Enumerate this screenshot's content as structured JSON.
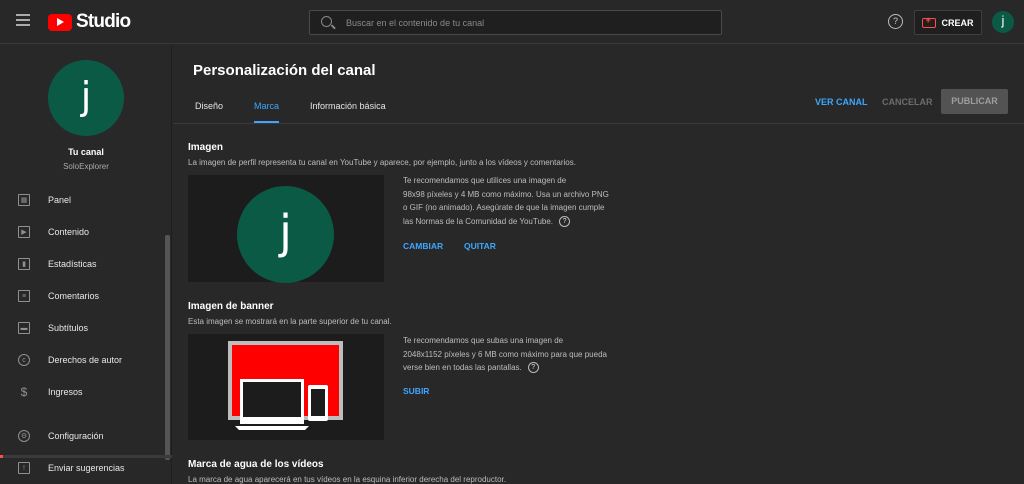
{
  "header": {
    "app_name": "Studio",
    "search_placeholder": "Buscar en el contenido de tu canal",
    "create_label": "CREAR",
    "avatar_letter": "j",
    "help_glyph": "?"
  },
  "sidebar": {
    "avatar_letter": "j",
    "channel_title": "Tu canal",
    "channel_name": "SoloExplorer",
    "items": [
      {
        "label": "Panel",
        "icon": "dashboard-icon"
      },
      {
        "label": "Contenido",
        "icon": "content-icon"
      },
      {
        "label": "Estadísticas",
        "icon": "analytics-icon"
      },
      {
        "label": "Comentarios",
        "icon": "comments-icon"
      },
      {
        "label": "Subtítulos",
        "icon": "subtitles-icon"
      },
      {
        "label": "Derechos de autor",
        "icon": "copyright-icon"
      },
      {
        "label": "Ingresos",
        "icon": "dollar-icon"
      }
    ],
    "bottom_items": [
      {
        "label": "Configuración",
        "icon": "gear-icon"
      },
      {
        "label": "Enviar sugerencias",
        "icon": "feedback-icon"
      }
    ]
  },
  "main": {
    "title": "Personalización del canal",
    "tabs": [
      {
        "label": "Diseño",
        "active": false
      },
      {
        "label": "Marca",
        "active": true
      },
      {
        "label": "Información básica",
        "active": false
      }
    ],
    "actions": {
      "view_channel": "VER CANAL",
      "cancel": "CANCELAR",
      "publish": "PUBLICAR"
    },
    "image_section": {
      "title": "Imagen",
      "description": "La imagen de perfil representa tu canal en YouTube y aparece, por ejemplo, junto a los vídeos y comentarios.",
      "preview_letter": "j",
      "info_lines": [
        "Te recomendamos que utilices una imagen de",
        "98x98 píxeles y 4 MB como máximo. Usa un archivo PNG",
        "o GIF (no animado). Asegúrate de que la imagen cumple",
        "las Normas de la Comunidad de YouTube."
      ],
      "change_label": "CAMBIAR",
      "remove_label": "QUITAR"
    },
    "banner_section": {
      "title": "Imagen de banner",
      "description": "Esta imagen se mostrará en la parte superior de tu canal.",
      "info_lines": [
        "Te recomendamos que subas una imagen de",
        "2048x1152 píxeles y 6 MB como máximo para que pueda",
        "verse bien en todas las pantallas."
      ],
      "upload_label": "SUBIR"
    },
    "watermark_section": {
      "title": "Marca de agua de los vídeos",
      "description": "La marca de agua aparecerá en tus vídeos en la esquina inferior derecha del reproductor."
    }
  },
  "colors": {
    "brand_red": "#ff0000",
    "accent_blue": "#3ea6ff",
    "avatar_green": "#0b5a45",
    "banner_red": "#ff0000"
  }
}
